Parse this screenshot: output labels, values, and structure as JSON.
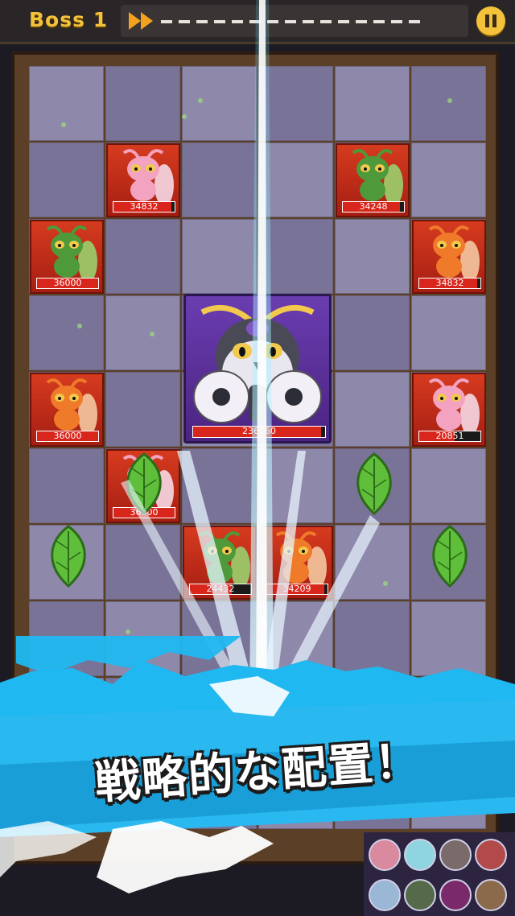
{
  "header": {
    "stage_label": "Boss 1",
    "progress_fraction": 0.0
  },
  "board": {
    "enemies": [
      {
        "hp_label": "34832",
        "kind": "pink-moth",
        "hp_fraction": 0.95
      },
      {
        "hp_label": "34248",
        "kind": "green-mantis",
        "hp_fraction": 0.94
      },
      {
        "hp_label": "36000",
        "kind": "green-mantis",
        "hp_fraction": 1.0
      },
      {
        "hp_label": "34832",
        "kind": "orange-moth",
        "hp_fraction": 0.95
      },
      {
        "hp_label": "36000",
        "kind": "orange-moth",
        "hp_fraction": 1.0
      },
      {
        "hp_label": "20851",
        "kind": "pink-moth",
        "hp_fraction": 0.58
      },
      {
        "hp_label": "36000",
        "kind": "pink-moth",
        "hp_fraction": 1.0
      },
      {
        "hp_label": "24432",
        "kind": "green-mantis",
        "hp_fraction": 0.68
      },
      {
        "hp_label": "34209",
        "kind": "orange-moth",
        "hp_fraction": 0.95
      }
    ],
    "boss": {
      "hp_label": "236160",
      "kind": "purple-owl-moth",
      "hp_fraction": 0.97
    },
    "leaves": [
      "leaf-icon",
      "leaf-icon",
      "leaf-icon",
      "leaf-icon"
    ]
  },
  "banner": {
    "headline": "戦略的な配置！"
  },
  "colors": {
    "accent": "#f3c13a",
    "splash": "#1fb8f0",
    "enemy_tile": "#c52a18",
    "boss_tile": "#5a2f99"
  }
}
